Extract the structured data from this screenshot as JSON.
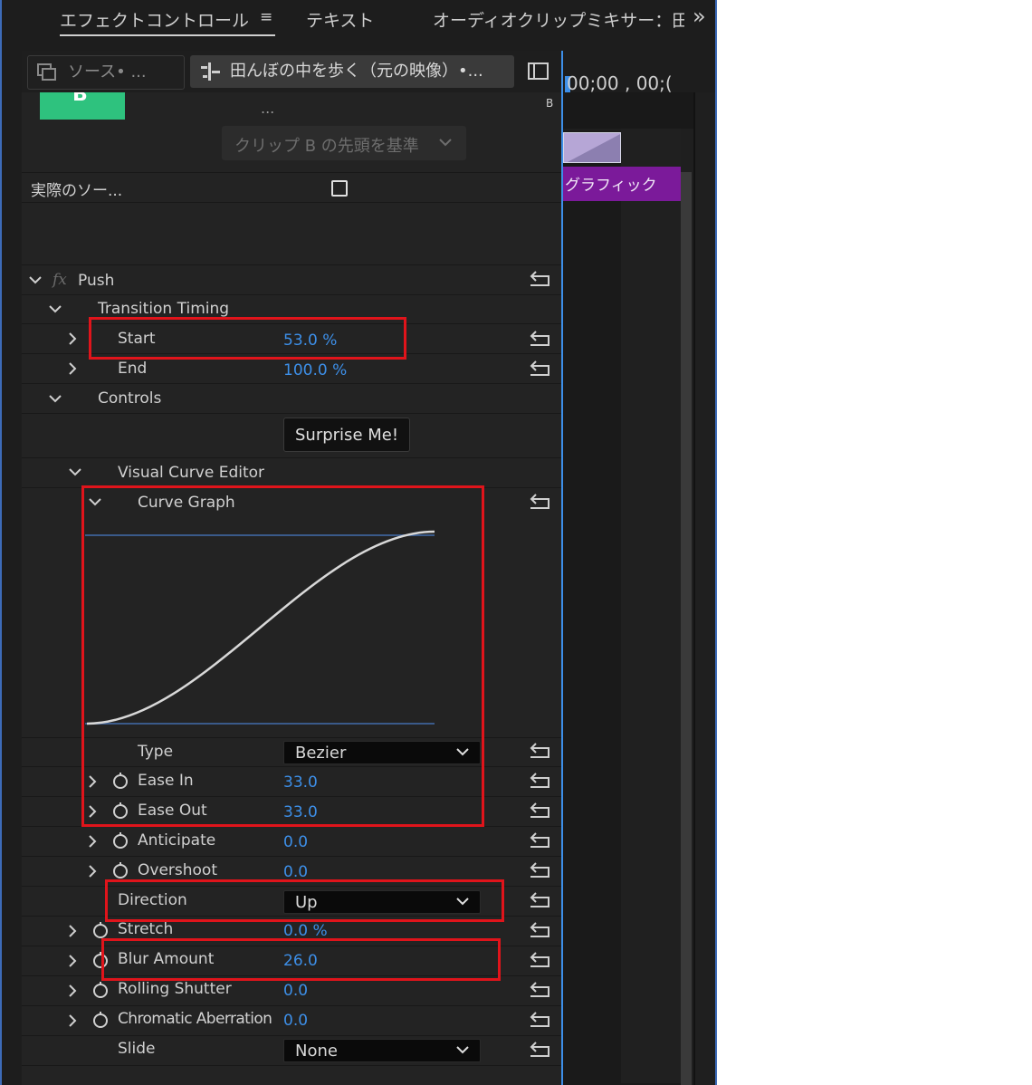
{
  "tabs": {
    "effect_controls": "エフェクトコントロール",
    "menu_glyph": "≡",
    "text": "テキスト",
    "audio_mixer": "オーディオクリップミキサー：田",
    "overflow": "»"
  },
  "header": {
    "source": "ソース• ...",
    "clip": "田んぼの中を歩く（元の映像）•..."
  },
  "timeline": {
    "timecode": "00;00 , 00;(",
    "marker_b": "B",
    "graphic_label": "グラフィック",
    "colors": {
      "graphic": "#7b1a9a",
      "transition": "#b6a6d6",
      "playhead": "#3d8fe8"
    }
  },
  "transition": {
    "badge": "B",
    "dots": "...",
    "align_label": "クリップ B の先頭を基準"
  },
  "actual_source_label": "実際のソー...",
  "effect": {
    "name": "Push",
    "fx_glyph": "fx"
  },
  "timing": {
    "label": "Transition Timing",
    "start_label": "Start",
    "start_value": "53.0 %",
    "end_label": "End",
    "end_value": "100.0 %"
  },
  "controls": {
    "label": "Controls",
    "surprise_button": "Surprise Me!"
  },
  "curve_editor": {
    "label": "Visual Curve Editor",
    "graph_label": "Curve Graph",
    "type_label": "Type",
    "type_value": "Bezier",
    "ease_in_label": "Ease In",
    "ease_in_value": "33.0",
    "ease_out_label": "Ease Out",
    "ease_out_value": "33.0",
    "anticipate_label": "Anticipate",
    "anticipate_value": "0.0",
    "overshoot_label": "Overshoot",
    "overshoot_value": "0.0",
    "direction_label": "Direction",
    "direction_value": "Up"
  },
  "params": {
    "stretch_label": "Stretch",
    "stretch_value": "0.0 %",
    "blur_label": "Blur Amount",
    "blur_value": "26.0",
    "rolling_label": "Rolling Shutter",
    "rolling_value": "0.0",
    "chromatic_label": "Chromatic Aberration",
    "chromatic_value": "0.0",
    "slide_label": "Slide",
    "slide_value": "None"
  },
  "colors": {
    "value_blue": "#3d8fe8",
    "highlight_red": "#e0141b",
    "badge_green": "#2ec27e"
  }
}
